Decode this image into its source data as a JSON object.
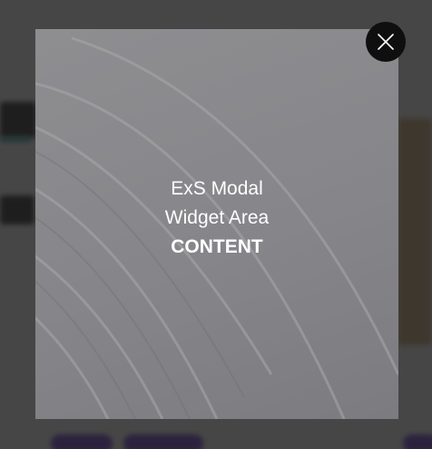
{
  "modal": {
    "line1": "ExS Modal",
    "line2": "Widget Area",
    "line3": "CONTENT"
  },
  "close_button": {
    "icon": "close-icon",
    "color": "#0f0f0f"
  },
  "colors": {
    "overlay": "#1c1c1c",
    "modal_background": "#88888c",
    "text": "#ffffff"
  }
}
